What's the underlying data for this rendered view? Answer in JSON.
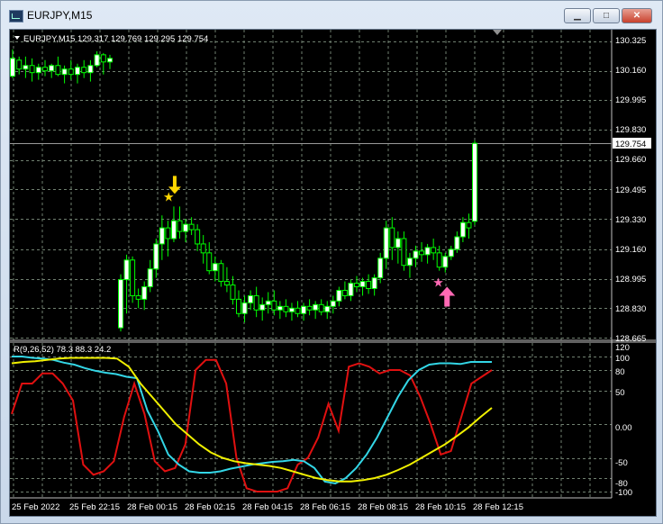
{
  "window": {
    "title": "EURJPY,M15",
    "minimize_label": "▁",
    "maximize_label": "□",
    "close_label": "✕"
  },
  "price_panel": {
    "header": "EURJPY,M15  129.317 129.769 129.295 129.754",
    "price_labels": [
      "130.325",
      "130.160",
      "129.995",
      "129.830",
      "129.660",
      "129.495",
      "129.330",
      "129.160",
      "128.995",
      "128.830",
      "128.665"
    ],
    "current_price": "129.754",
    "colors": {
      "bull": "#ffffff",
      "bear": "#000000",
      "wick": "#00ff00",
      "grid": "#708070",
      "background": "#000000",
      "buy_arrow": "#ff69b4",
      "sell_arrow": "#ffd700"
    }
  },
  "indicator_panel": {
    "header": "R(9,26,52) 78.3 88.3 24.2",
    "levels": [
      "120",
      "100",
      "80",
      "50",
      "0.00",
      "-50",
      "-80",
      "-100"
    ],
    "series_colors": {
      "fast": "#e01010",
      "medium": "#33d6e6",
      "slow": "#f0f000"
    }
  },
  "time_labels": [
    "25 Feb 2022",
    "25 Feb 22:15",
    "28 Feb 00:15",
    "28 Feb 02:15",
    "28 Feb 04:15",
    "28 Feb 06:15",
    "28 Feb 08:15",
    "28 Feb 10:15",
    "28 Feb 12:15"
  ],
  "chart_data": {
    "type": "candlestick",
    "symbol": "EURJPY",
    "timeframe": "M15",
    "ohlc_last": {
      "open": 129.317,
      "high": 129.769,
      "low": 129.295,
      "close": 129.754
    },
    "ylim": [
      128.665,
      130.325
    ],
    "candles": [
      [
        130.13,
        130.28,
        130.12,
        130.23
      ],
      [
        130.22,
        130.24,
        130.14,
        130.17
      ],
      [
        130.17,
        130.24,
        130.12,
        130.19
      ],
      [
        130.19,
        130.23,
        130.1,
        130.15
      ],
      [
        130.15,
        130.2,
        130.11,
        130.18
      ],
      [
        130.18,
        130.22,
        130.13,
        130.16
      ],
      [
        130.16,
        130.2,
        130.12,
        130.19
      ],
      [
        130.19,
        130.24,
        130.13,
        130.14
      ],
      [
        130.14,
        130.19,
        130.09,
        130.17
      ],
      [
        130.17,
        130.22,
        130.11,
        130.14
      ],
      [
        130.14,
        130.2,
        130.09,
        130.18
      ],
      [
        130.18,
        130.22,
        130.12,
        130.15
      ],
      [
        130.15,
        130.22,
        130.1,
        130.19
      ],
      [
        130.19,
        130.27,
        130.18,
        130.25
      ],
      [
        130.25,
        130.26,
        130.14,
        130.21
      ],
      [
        130.21,
        130.25,
        130.17,
        130.23
      ],
      [
        128.72,
        129.02,
        128.7,
        128.99
      ],
      [
        128.99,
        129.13,
        128.8,
        129.1
      ],
      [
        129.1,
        129.12,
        128.86,
        128.9
      ],
      [
        128.9,
        128.94,
        128.83,
        128.88
      ],
      [
        128.88,
        128.98,
        128.82,
        128.95
      ],
      [
        128.95,
        129.1,
        128.92,
        129.05
      ],
      [
        129.05,
        129.22,
        129.0,
        129.19
      ],
      [
        129.19,
        129.35,
        129.1,
        129.28
      ],
      [
        129.28,
        129.32,
        129.12,
        129.22
      ],
      [
        129.22,
        129.4,
        129.2,
        129.32
      ],
      [
        129.32,
        129.4,
        129.22,
        129.26
      ],
      [
        129.26,
        129.33,
        129.2,
        129.3
      ],
      [
        129.3,
        129.34,
        129.24,
        129.27
      ],
      [
        129.27,
        129.3,
        129.15,
        129.19
      ],
      [
        129.19,
        129.24,
        129.08,
        129.14
      ],
      [
        129.14,
        129.2,
        129.02,
        129.04
      ],
      [
        129.04,
        129.12,
        128.98,
        129.08
      ],
      [
        129.08,
        129.1,
        128.95,
        128.98
      ],
      [
        128.98,
        129.06,
        128.92,
        128.96
      ],
      [
        128.96,
        129.01,
        128.85,
        128.88
      ],
      [
        128.88,
        128.93,
        128.78,
        128.8
      ],
      [
        128.8,
        128.9,
        128.75,
        128.86
      ],
      [
        128.86,
        128.93,
        128.82,
        128.9
      ],
      [
        128.9,
        128.95,
        128.78,
        128.82
      ],
      [
        128.82,
        128.89,
        128.76,
        128.85
      ],
      [
        128.85,
        128.92,
        128.8,
        128.87
      ],
      [
        128.87,
        128.93,
        128.79,
        128.82
      ],
      [
        128.82,
        128.87,
        128.77,
        128.84
      ],
      [
        128.84,
        128.88,
        128.78,
        128.81
      ],
      [
        128.81,
        128.86,
        128.76,
        128.83
      ],
      [
        128.83,
        128.87,
        128.78,
        128.8
      ],
      [
        128.8,
        128.86,
        128.76,
        128.84
      ],
      [
        128.84,
        128.88,
        128.79,
        128.82
      ],
      [
        128.82,
        128.87,
        128.77,
        128.85
      ],
      [
        128.85,
        128.88,
        128.79,
        128.81
      ],
      [
        128.81,
        128.87,
        128.77,
        128.84
      ],
      [
        128.84,
        128.9,
        128.8,
        128.87
      ],
      [
        128.87,
        128.95,
        128.84,
        128.93
      ],
      [
        128.93,
        128.98,
        128.88,
        128.9
      ],
      [
        128.9,
        128.99,
        128.87,
        128.97
      ],
      [
        128.97,
        129.01,
        128.92,
        128.95
      ],
      [
        128.95,
        129.0,
        128.9,
        128.98
      ],
      [
        128.98,
        129.02,
        128.91,
        128.94
      ],
      [
        128.94,
        129.02,
        128.9,
        129.0
      ],
      [
        129.0,
        129.14,
        128.97,
        129.11
      ],
      [
        129.11,
        129.32,
        129.05,
        129.28
      ],
      [
        129.28,
        129.34,
        129.1,
        129.17
      ],
      [
        129.17,
        129.26,
        129.08,
        129.22
      ],
      [
        129.22,
        129.26,
        129.04,
        129.07
      ],
      [
        129.07,
        129.14,
        129.0,
        129.11
      ],
      [
        129.11,
        129.18,
        129.06,
        129.15
      ],
      [
        129.15,
        129.2,
        129.09,
        129.13
      ],
      [
        129.13,
        129.19,
        129.08,
        129.17
      ],
      [
        129.17,
        129.22,
        129.1,
        129.14
      ],
      [
        129.14,
        129.18,
        129.04,
        129.06
      ],
      [
        129.06,
        129.14,
        129.03,
        129.12
      ],
      [
        129.12,
        129.18,
        129.1,
        129.16
      ],
      [
        129.16,
        129.26,
        129.14,
        129.23
      ],
      [
        129.23,
        129.34,
        129.2,
        129.31
      ],
      [
        129.31,
        129.36,
        129.22,
        129.28
      ],
      [
        129.317,
        129.769,
        129.295,
        129.754
      ]
    ],
    "signals": [
      {
        "type": "sell",
        "candle": 25,
        "price": 129.46
      },
      {
        "type": "buy",
        "candle": 71,
        "price": 128.96
      }
    ],
    "indicator": {
      "name": "R(9,26,52)",
      "values": [
        78.3,
        88.3,
        24.2
      ],
      "ylim": [
        -105,
        120
      ],
      "series": [
        {
          "name": "R9",
          "color": "#e01010",
          "values": [
            15,
            60,
            60,
            75,
            75,
            60,
            35,
            -60,
            -75,
            -70,
            -55,
            10,
            60,
            15,
            -55,
            -70,
            -65,
            -30,
            80,
            95,
            95,
            60,
            -50,
            -95,
            -100,
            -100,
            -100,
            -95,
            -60,
            -50,
            -20,
            30,
            -10,
            85,
            90,
            85,
            75,
            80,
            80,
            72,
            40,
            0,
            -45,
            -40,
            10,
            60,
            70,
            80
          ]
        },
        {
          "name": "R26",
          "color": "#33d6e6",
          "values": [
            100,
            100,
            98,
            97,
            95,
            91,
            88,
            83,
            79,
            76,
            74,
            70,
            68,
            20,
            -10,
            -45,
            -60,
            -70,
            -72,
            -72,
            -70,
            -66,
            -63,
            -60,
            -58,
            -56,
            -55,
            -53,
            -55,
            -65,
            -85,
            -88,
            -80,
            -65,
            -45,
            -20,
            10,
            40,
            65,
            80,
            88,
            90,
            90,
            89,
            92,
            92,
            92
          ]
        },
        {
          "name": "R52",
          "color": "#f0f000",
          "values": [
            90,
            92,
            93,
            95,
            97,
            98,
            98,
            98,
            98,
            97,
            85,
            60,
            40,
            20,
            0,
            -15,
            -30,
            -42,
            -50,
            -55,
            -58,
            -60,
            -62,
            -65,
            -70,
            -75,
            -80,
            -83,
            -85,
            -85,
            -83,
            -80,
            -75,
            -68,
            -60,
            -50,
            -40,
            -30,
            -18,
            -5,
            10,
            24
          ]
        }
      ]
    }
  }
}
